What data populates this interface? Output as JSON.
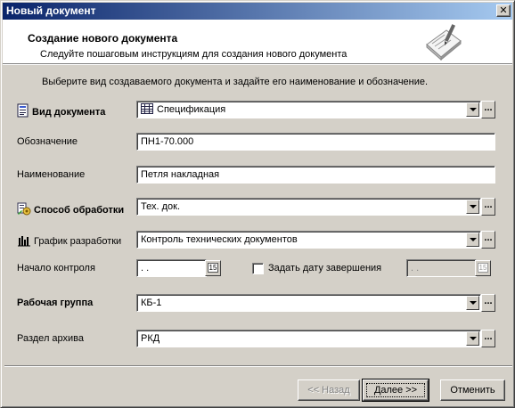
{
  "window": {
    "title": "Новый документ",
    "close_glyph": "✕"
  },
  "header": {
    "title": "Создание нового документа",
    "subtitle": "Следуйте пошаговым инструкциям для создания нового документа",
    "icon": "wizard-document-icon"
  },
  "intro": "Выберите вид создаваемого документа и задайте его наименование и обозначение.",
  "fields": {
    "doc_type": {
      "label": "Вид документа",
      "value": "Спецификация",
      "icon": "spec-table-icon"
    },
    "designation": {
      "label": "Обозначение",
      "value": "ПН1-70.000"
    },
    "name": {
      "label": "Наименование",
      "value": "Петля накладная"
    },
    "processing": {
      "label": "Способ обработки",
      "value": "Тех. док.",
      "icon": "processing-icon"
    },
    "schedule": {
      "label": "График разработки",
      "value": "Контроль технических документов",
      "icon": "chart-icon"
    },
    "control_start": {
      "label": "Начало контроля",
      "value": ". .",
      "calendar_glyph": "15"
    },
    "end_date": {
      "label": "Задать дату завершения",
      "checked": false,
      "value": ". .",
      "calendar_glyph": "15"
    },
    "work_group": {
      "label": "Рабочая группа",
      "value": "КБ-1"
    },
    "archive": {
      "label": "Раздел архива",
      "value": "РКД"
    }
  },
  "ellipsis": "...",
  "buttons": {
    "back": "<< Назад",
    "next": "Далее >>",
    "cancel": "Отменить"
  }
}
